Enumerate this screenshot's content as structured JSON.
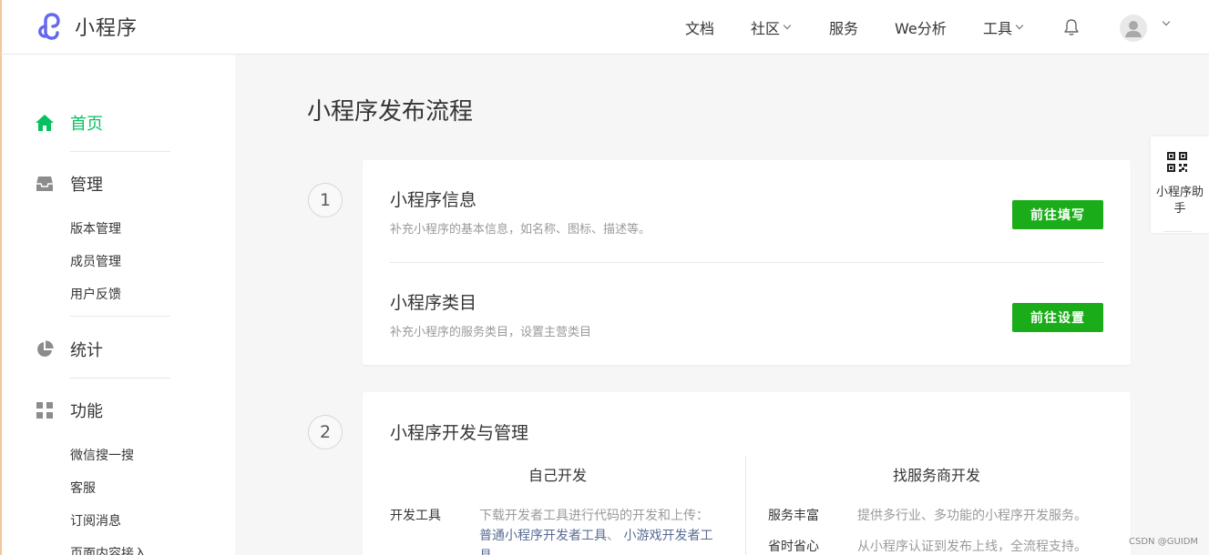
{
  "header": {
    "logo_text": "小程序",
    "nav": {
      "docs": "文档",
      "community": "社区",
      "service": "服务",
      "analytics": "We分析",
      "tools": "工具"
    }
  },
  "sidebar": {
    "home": "首页",
    "manage": "管理",
    "manage_items": [
      "版本管理",
      "成员管理",
      "用户反馈"
    ],
    "stats": "统计",
    "features": "功能",
    "feature_items": [
      "微信搜一搜",
      "客服",
      "订阅消息",
      "页面内容接入"
    ]
  },
  "main": {
    "title": "小程序发布流程",
    "steps": [
      {
        "number": "1",
        "items": [
          {
            "title": "小程序信息",
            "desc": "补充小程序的基本信息，如名称、图标、描述等。",
            "button": "前往填写"
          },
          {
            "title": "小程序类目",
            "desc": "补充小程序的服务类目，设置主营类目",
            "button": "前往设置"
          }
        ]
      },
      {
        "number": "2",
        "title": "小程序开发与管理",
        "self_dev": {
          "heading": "自己开发",
          "label": "开发工具",
          "text": "下载开发者工具进行代码的开发和上传：",
          "link1": "普通小程序开发者工具",
          "sep": "、",
          "link2": "小游戏开发者工具"
        },
        "vendor_dev": {
          "heading": "找服务商开发",
          "rows": [
            {
              "label": "服务丰富",
              "text": "提供多行业、多功能的小程序开发服务。"
            },
            {
              "label": "省时省心",
              "text": "从小程序认证到发布上线，全流程支持。"
            }
          ]
        }
      }
    ]
  },
  "float_helper": {
    "label": "小程序助手"
  },
  "watermark": "CSDN @GUIDM",
  "colors": {
    "accent_green": "#07c160",
    "button_green": "#1aad19",
    "link_blue": "#576b95",
    "logo_purple": "#6467f0"
  }
}
